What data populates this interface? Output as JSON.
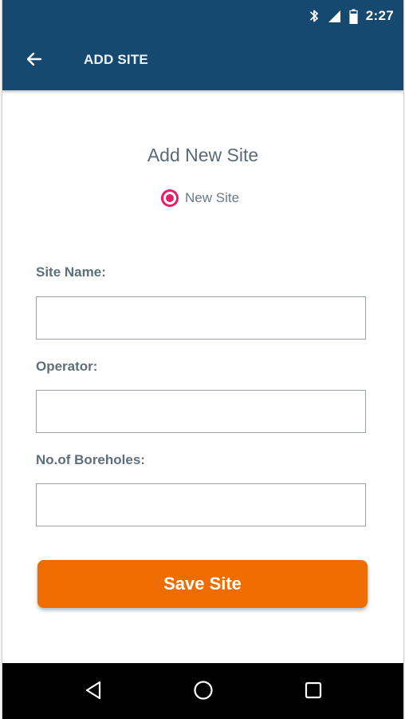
{
  "status_bar": {
    "time": "2:27",
    "icons": [
      "bluetooth-icon",
      "cell-signal-icon",
      "battery-icon"
    ]
  },
  "app_bar": {
    "title": "ADD SITE",
    "back_icon": "arrow-left-icon",
    "background_color": "#15496f"
  },
  "form": {
    "title": "Add New Site",
    "radio": {
      "label": "New Site",
      "selected": true,
      "color": "#e91e63"
    },
    "fields": [
      {
        "label": "Site Name:",
        "value": ""
      },
      {
        "label": "Operator:",
        "value": ""
      },
      {
        "label": "No.of Boreholes:",
        "value": ""
      }
    ],
    "save_button": {
      "label": "Save Site",
      "color": "#ef6c00"
    }
  },
  "nav_bar": {
    "icons": [
      "back-triangle-icon",
      "home-circle-icon",
      "recents-square-icon"
    ]
  }
}
